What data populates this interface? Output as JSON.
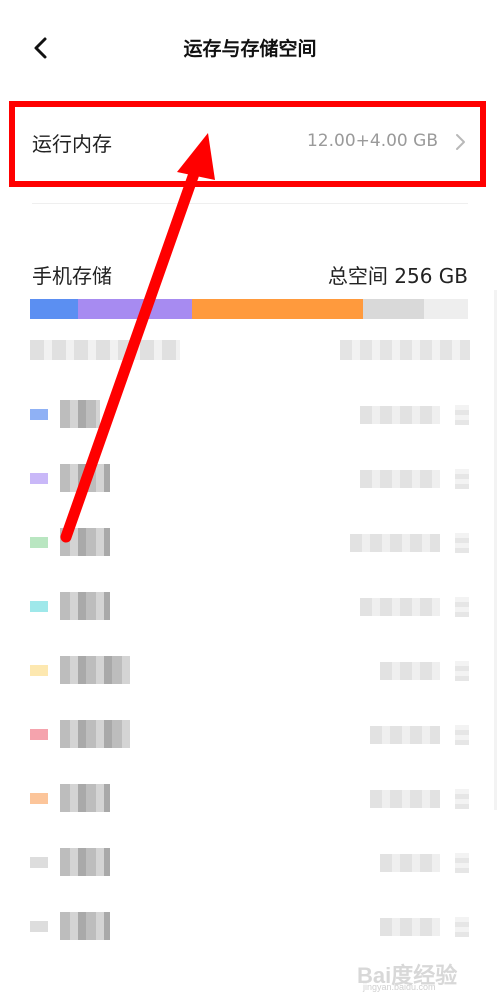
{
  "header": {
    "title": "运存与存储空间",
    "back_icon": "chevron-left-icon"
  },
  "ram": {
    "label": "运行内存",
    "value": "12.00+4.00 GB",
    "chevron_icon": "chevron-right-icon"
  },
  "storage": {
    "label": "手机存储",
    "total": "总空间 256 GB",
    "bar_segments": [
      {
        "color": "#5b8ff2",
        "fraction": 0.11
      },
      {
        "color": "#a78bf1",
        "fraction": 0.26
      },
      {
        "color": "#ff9a3d",
        "fraction": 0.39
      },
      {
        "color": "#d9d9d9",
        "fraction": 0.14
      },
      {
        "color": "#eeeeee",
        "fraction": 0.1
      }
    ],
    "categories": [
      {
        "color": "#8fb1f5"
      },
      {
        "color": "#c9b8f8"
      },
      {
        "color": "#b9e6c1"
      },
      {
        "color": "#9fe8ea"
      },
      {
        "color": "#fde8b0"
      },
      {
        "color": "#f5a3ad"
      },
      {
        "color": "#fcc59a"
      },
      {
        "color": "#dddddd"
      },
      {
        "color": "#dddddd"
      }
    ]
  },
  "annotation": {
    "color": "#ff0000"
  },
  "watermark": {
    "logo": "Bai度经验",
    "sub": "jingyan.baidu.com"
  }
}
